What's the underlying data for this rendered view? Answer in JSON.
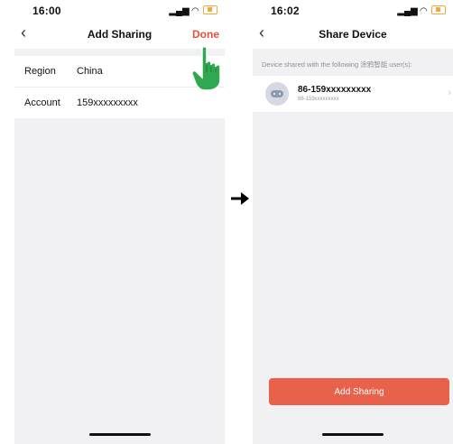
{
  "left_screen": {
    "status_time": "16:00",
    "title": "Add Sharing",
    "done_label": "Done",
    "rows": [
      {
        "label": "Region",
        "value": "China"
      },
      {
        "label": "Account",
        "value": "159xxxxxxxxx"
      }
    ]
  },
  "right_screen": {
    "status_time": "16:02",
    "title": "Share Device",
    "description": "Device shared with the following 涂鸦智能 user(s):",
    "shared_user": {
      "name": "86-159xxxxxxxxx",
      "subtitle": "86-159xxxxxxxxx"
    },
    "add_sharing_label": "Add Sharing"
  },
  "icons": {
    "back": "chevron-left-icon",
    "signal": "signal-icon",
    "wifi": "wifi-icon",
    "battery": "battery-charging-icon",
    "transition": "arrow-right-icon",
    "pointer": "pointing-hand-icon",
    "avatar": "robot-avatar-icon"
  },
  "colors": {
    "accent": "#e0533a",
    "button": "#e7614b",
    "pointer": "#2fa84f",
    "background": "#f1f1f4"
  }
}
